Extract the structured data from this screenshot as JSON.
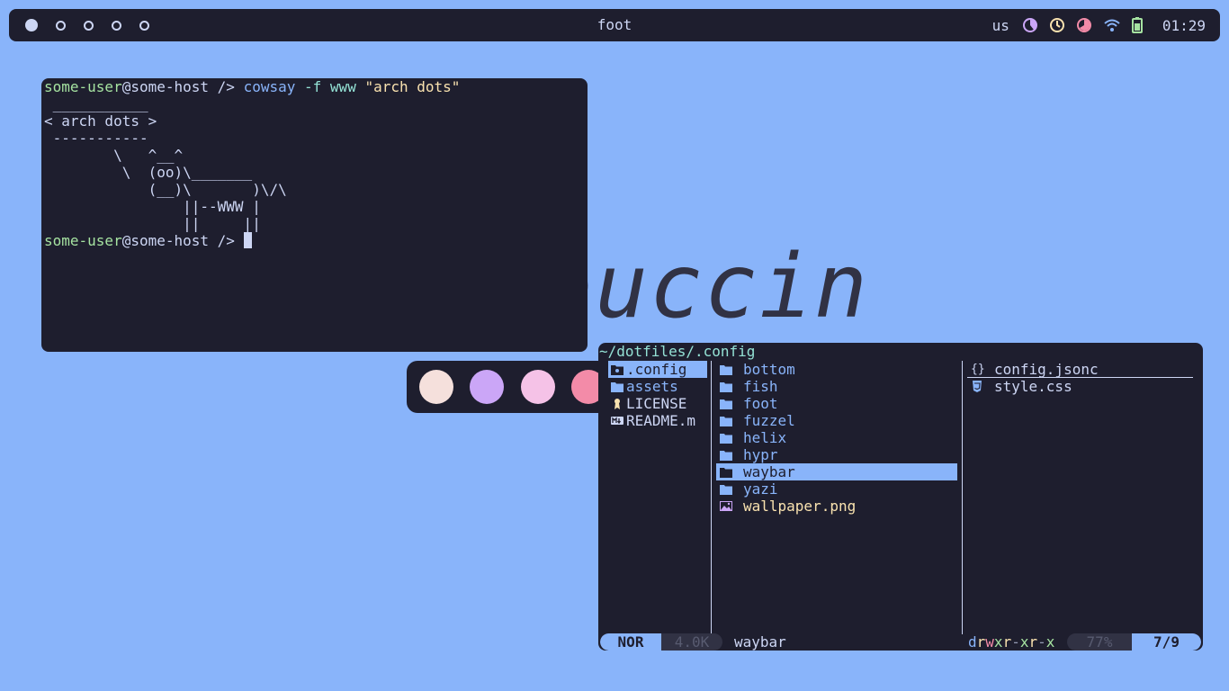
{
  "topbar": {
    "title": "foot",
    "keyboard_layout": "us",
    "clock": "01:29",
    "icons": [
      "cpu-pie-icon",
      "timer-icon",
      "memory-pie-icon",
      "wifi-icon",
      "battery-icon"
    ],
    "colors": {
      "purple": "#cba6f7",
      "yellow": "#f9e2af",
      "red": "#f38ba8",
      "blue": "#89b4fa",
      "green": "#a6e3a1"
    }
  },
  "wallpaper": {
    "text": "ouccin"
  },
  "terminal": {
    "prompt_user": "some-user",
    "prompt_host": "@some-host",
    "prompt_dir": " />",
    "cmd_name": "cowsay",
    "cmd_flag": "-f",
    "cmd_arg": "www",
    "cmd_string": "\"arch dots\"",
    "output": " ___________\n< arch dots >\n -----------\n        \\   ^__^\n         \\  (oo)\\_______\n            (__)\\       )\\/\\\n                ||--WWW |\n                ||     ||"
  },
  "palette": [
    "#f5e0dc",
    "#cba6f7",
    "#f5c2e7",
    "#f38ba8"
  ],
  "yazi": {
    "path": "~/dotfiles/.config",
    "parent": [
      {
        "name": ".config",
        "icon": "config-folder-icon",
        "selected": true
      },
      {
        "name": "assets",
        "icon": "folder-icon"
      },
      {
        "name": "LICENSE",
        "icon": "license-icon"
      },
      {
        "name": "README.m",
        "icon": "markdown-icon"
      }
    ],
    "current": [
      {
        "name": "bottom",
        "icon": "folder-icon"
      },
      {
        "name": "fish",
        "icon": "folder-icon"
      },
      {
        "name": "foot",
        "icon": "folder-icon"
      },
      {
        "name": "fuzzel",
        "icon": "folder-icon"
      },
      {
        "name": "helix",
        "icon": "folder-icon"
      },
      {
        "name": "hypr",
        "icon": "folder-icon"
      },
      {
        "name": "waybar",
        "icon": "folder-icon",
        "selected": true
      },
      {
        "name": "yazi",
        "icon": "folder-icon"
      },
      {
        "name": "wallpaper.png",
        "icon": "image-icon"
      }
    ],
    "preview": [
      {
        "name": "config.jsonc",
        "icon": "json-icon"
      },
      {
        "name": "style.css",
        "icon": "css-icon"
      }
    ],
    "status": {
      "mode": "NOR",
      "size": "4.0K",
      "name": "waybar",
      "perm_d": "d",
      "perm_r1": "r",
      "perm_w1": "w",
      "perm_x1": "x",
      "perm_r2": "r",
      "perm_d2": "-",
      "perm_x2": "x",
      "perm_r3": "r",
      "perm_d3": "-",
      "perm_x3": "x",
      "percent": "77%",
      "position": "7/9"
    }
  }
}
